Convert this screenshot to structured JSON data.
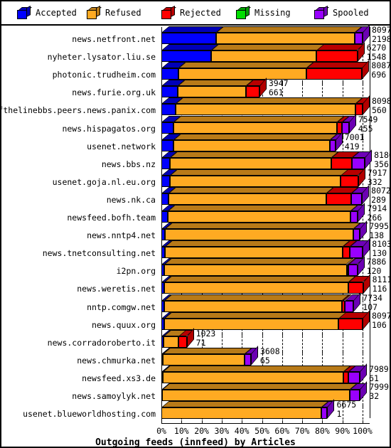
{
  "legend": {
    "items": [
      {
        "label": "Accepted",
        "color": "#0000ff",
        "icon": "cube-icon"
      },
      {
        "label": "Refused",
        "color": "#ffaa22",
        "icon": "cube-icon"
      },
      {
        "label": "Rejected",
        "color": "#ff0000",
        "icon": "cube-icon"
      },
      {
        "label": "Missing",
        "color": "#00dd00",
        "icon": "cube-icon"
      },
      {
        "label": "Spooled",
        "color": "#9900ff",
        "icon": "cube-icon"
      }
    ]
  },
  "chart_data": {
    "type": "bar",
    "orientation": "horizontal",
    "stacked": true,
    "percent_of_max": true,
    "title": "Outgoing feeds (innfeed) by Articles",
    "xlabel": "",
    "ylabel": "",
    "xlim": [
      0,
      100
    ],
    "xticks": [
      "0%",
      "10%",
      "20%",
      "30%",
      "40%",
      "50%",
      "60%",
      "70%",
      "80%",
      "90%",
      "100%"
    ],
    "grid": true,
    "legend_position": "top",
    "series_names": [
      "Accepted",
      "Refused",
      "Rejected",
      "Missing",
      "Spooled"
    ],
    "series_colors": [
      "#0000ff",
      "#ffaa22",
      "#ff0000",
      "#00dd00",
      "#9900ff"
    ],
    "categories": [
      "news.netfront.net",
      "nyheter.lysator.liu.se",
      "photonic.trudheim.com",
      "news.furie.org.uk",
      "endofthelinebbs.peers.news.panix.com",
      "news.hispagatos.org",
      "usenet.network",
      "news.bbs.nz",
      "usenet.goja.nl.eu.org",
      "news.nk.ca",
      "newsfeed.bofh.team",
      "news.nntp4.net",
      "news.tnetconsulting.net",
      "i2pn.org",
      "news.weretis.net",
      "nntp.comgw.net",
      "news.quux.org",
      "news.corradoroberto.it",
      "news.chmurka.net",
      "newsfeed.xs3.de",
      "news.samoylyk.net",
      "usenet.blueworldhosting.com"
    ],
    "rows": [
      {
        "category": "news.netfront.net",
        "total": 8097,
        "label_top": "8097",
        "label_bottom": "2198",
        "accepted_pct": 27.1,
        "refused_pct": 69.0,
        "rejected_pct": 0.0,
        "missing_pct": 0.0,
        "spooled_pct": 3.9,
        "total_pct": 100.0
      },
      {
        "category": "nyheter.lysator.liu.se",
        "total": 6270,
        "label_top": "6270",
        "label_bottom": "1548",
        "accepted_pct": 24.7,
        "refused_pct": 52.5,
        "rejected_pct": 20.2,
        "missing_pct": 0.0,
        "spooled_pct": 0.0,
        "total_pct": 77.4
      },
      {
        "category": "photonic.trudheim.com",
        "total": 8087,
        "label_top": "8087",
        "label_bottom": "696",
        "accepted_pct": 8.6,
        "refused_pct": 63.5,
        "rejected_pct": 27.7,
        "missing_pct": 0.0,
        "spooled_pct": 0.0,
        "total_pct": 99.9
      },
      {
        "category": "news.furie.org.uk",
        "total": 3947,
        "label_top": "3947",
        "label_bottom": "661",
        "accepted_pct": 8.2,
        "refused_pct": 33.9,
        "rejected_pct": 6.6,
        "missing_pct": 0.0,
        "spooled_pct": 0.0,
        "total_pct": 48.7
      },
      {
        "category": "endofthelinebbs.peers.news.panix.com",
        "total": 8098,
        "label_top": "8098",
        "label_bottom": "560",
        "accepted_pct": 6.9,
        "refused_pct": 89.5,
        "rejected_pct": 3.6,
        "missing_pct": 0.0,
        "spooled_pct": 0.0,
        "total_pct": 100.0
      },
      {
        "category": "news.hispagatos.org",
        "total": 7549,
        "label_top": "7549",
        "label_bottom": "455",
        "accepted_pct": 6.0,
        "refused_pct": 81.2,
        "rejected_pct": 2.6,
        "missing_pct": 0.0,
        "spooled_pct": 3.4,
        "total_pct": 93.2
      },
      {
        "category": "usenet.network",
        "total": 7001,
        "label_top": "7001",
        "label_bottom": "419",
        "accepted_pct": 6.0,
        "refused_pct": 77.8,
        "rejected_pct": 0.0,
        "missing_pct": 0.0,
        "spooled_pct": 2.7,
        "total_pct": 86.5
      },
      {
        "category": "news.bbs.nz",
        "total": 8186,
        "label_top": "8186",
        "label_bottom": "356",
        "accepted_pct": 4.3,
        "refused_pct": 80.3,
        "rejected_pct": 10.1,
        "missing_pct": 0.0,
        "spooled_pct": 6.4,
        "total_pct": 101.1
      },
      {
        "category": "usenet.goja.nl.eu.org",
        "total": 7917,
        "label_top": "7917",
        "label_bottom": "332",
        "accepted_pct": 4.2,
        "refused_pct": 85.0,
        "rejected_pct": 8.6,
        "missing_pct": 0.0,
        "spooled_pct": 0.0,
        "total_pct": 97.8
      },
      {
        "category": "news.nk.ca",
        "total": 8072,
        "label_top": "8072",
        "label_bottom": "289",
        "accepted_pct": 3.6,
        "refused_pct": 78.3,
        "rejected_pct": 12.4,
        "missing_pct": 0.0,
        "spooled_pct": 5.4,
        "total_pct": 99.7
      },
      {
        "category": "newsfeed.bofh.team",
        "total": 7914,
        "label_top": "7914",
        "label_bottom": "266",
        "accepted_pct": 3.3,
        "refused_pct": 90.7,
        "rejected_pct": 0.0,
        "missing_pct": 0.0,
        "spooled_pct": 3.7,
        "total_pct": 97.7
      },
      {
        "category": "news.nntp4.net",
        "total": 7995,
        "label_top": "7995",
        "label_bottom": "138",
        "accepted_pct": 1.7,
        "refused_pct": 93.6,
        "rejected_pct": 0.0,
        "missing_pct": 0.0,
        "spooled_pct": 3.4,
        "total_pct": 98.7
      },
      {
        "category": "news.tnetconsulting.net",
        "total": 8103,
        "label_top": "8103",
        "label_bottom": "130",
        "accepted_pct": 1.6,
        "refused_pct": 88.5,
        "rejected_pct": 3.4,
        "missing_pct": 0.0,
        "spooled_pct": 6.6,
        "total_pct": 100.1
      },
      {
        "category": "i2pn.org",
        "total": 7886,
        "label_top": "7886",
        "label_bottom": "120",
        "accepted_pct": 1.5,
        "refused_pct": 90.6,
        "rejected_pct": 0.9,
        "missing_pct": 0.0,
        "spooled_pct": 4.4,
        "total_pct": 97.4
      },
      {
        "category": "news.weretis.net",
        "total": 8111,
        "label_top": "8111",
        "label_bottom": "116",
        "accepted_pct": 1.4,
        "refused_pct": 91.6,
        "rejected_pct": 7.2,
        "missing_pct": 0.0,
        "spooled_pct": 0.0,
        "total_pct": 100.2
      },
      {
        "category": "nntp.comgw.net",
        "total": 7734,
        "label_top": "7734",
        "label_bottom": "107",
        "accepted_pct": 1.4,
        "refused_pct": 88.5,
        "rejected_pct": 1.1,
        "missing_pct": 0.0,
        "spooled_pct": 4.5,
        "total_pct": 95.5
      },
      {
        "category": "news.quux.org",
        "total": 8097,
        "label_top": "8097",
        "label_bottom": "106",
        "accepted_pct": 1.3,
        "refused_pct": 86.8,
        "rejected_pct": 11.9,
        "missing_pct": 0.0,
        "spooled_pct": 0.0,
        "total_pct": 100.0
      },
      {
        "category": "news.corradoroberto.it",
        "total": 1023,
        "label_top": "1023",
        "label_bottom": "71",
        "accepted_pct": 0.9,
        "refused_pct": 7.7,
        "rejected_pct": 4.0,
        "missing_pct": 0.0,
        "spooled_pct": 0.0,
        "total_pct": 12.6
      },
      {
        "category": "news.chmurka.net",
        "total": 3608,
        "label_top": "3608",
        "label_bottom": "65",
        "accepted_pct": 0.8,
        "refused_pct": 40.5,
        "rejected_pct": 0.0,
        "missing_pct": 0.0,
        "spooled_pct": 3.2,
        "total_pct": 44.5
      },
      {
        "category": "newsfeed.xs3.de",
        "total": 7989,
        "label_top": "7989",
        "label_bottom": "61",
        "accepted_pct": 0.8,
        "refused_pct": 89.6,
        "rejected_pct": 2.4,
        "missing_pct": 0.0,
        "spooled_pct": 5.8,
        "total_pct": 98.6
      },
      {
        "category": "news.samoylyk.net",
        "total": 7999,
        "label_top": "7999",
        "label_bottom": "32",
        "accepted_pct": 0.4,
        "refused_pct": 93.2,
        "rejected_pct": 0.0,
        "missing_pct": 0.0,
        "spooled_pct": 5.1,
        "total_pct": 98.7
      },
      {
        "category": "usenet.blueworldhosting.com",
        "total": 6675,
        "label_top": "6675",
        "label_bottom": "1",
        "accepted_pct": 0.0,
        "refused_pct": 79.5,
        "rejected_pct": 0.0,
        "missing_pct": 0.0,
        "spooled_pct": 3.0,
        "total_pct": 82.5
      }
    ]
  }
}
